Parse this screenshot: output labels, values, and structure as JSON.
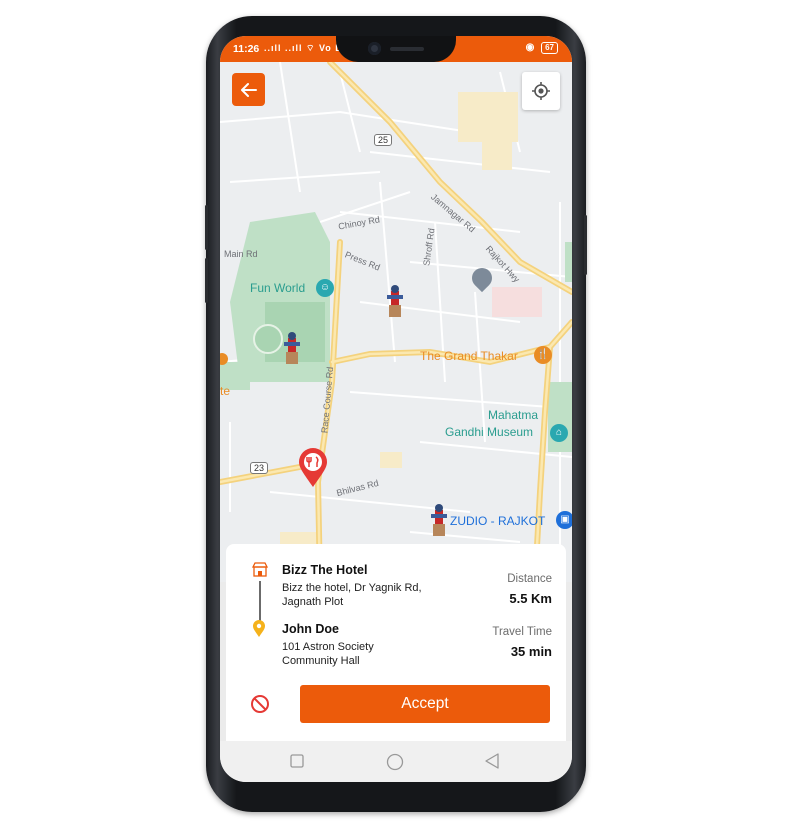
{
  "status_bar": {
    "time": "11:26",
    "signal_text": "..ıll ..ıll ⌔ Vo LTE",
    "battery": "67"
  },
  "map": {
    "roads": [
      "Main Rd",
      "Chinoy Rd",
      "Press Rd",
      "Shroff Rd",
      "Jamnagar Rd",
      "Rajkot Hwy",
      "Race Course Rd",
      "Bhilvas Rd"
    ],
    "route_shields": [
      "25",
      "23"
    ],
    "places": {
      "fun_world": "Fun World",
      "grand_thakar": "The Grand Thakar",
      "museum_line1": "Mahatma",
      "museum_line2": "Gandhi Museum",
      "zudio": "ZUDIO - RAJKOT",
      "partial": "te"
    }
  },
  "order": {
    "pickup_name": "Bizz The Hotel",
    "pickup_address": "Bizz the hotel, Dr Yagnik Rd, Jagnath Plot",
    "drop_name": "John Doe",
    "drop_address": "101 Astron Society Community Hall",
    "distance_label": "Distance",
    "distance_value": "5.5 Km",
    "time_label": "Travel Time",
    "time_value": "35 min",
    "accept_label": "Accept"
  },
  "colors": {
    "accent": "#ec5b0b",
    "pin": "#e53935"
  }
}
